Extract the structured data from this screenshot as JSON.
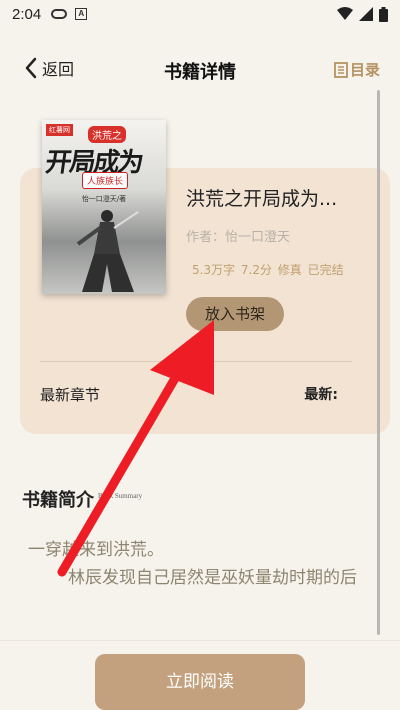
{
  "status_bar": {
    "time": "2:04",
    "icons": [
      "gamepad-icon",
      "a-icon",
      "wifi-icon",
      "signal-icon",
      "battery-icon"
    ]
  },
  "nav": {
    "back_label": "返回",
    "title": "书籍详情",
    "toc_label": "目录"
  },
  "book": {
    "title": "洪荒之开局成为...",
    "author": "作者：怡一口澄天",
    "meta": "5.3万字 7.2分 修真 已完结",
    "shelf_button": "放入书架",
    "latest_chapter_label": "最新章节",
    "latest_label": "最新:",
    "cover": {
      "badge": "红薯网",
      "top_tag": "洪荒之",
      "big_title": "开局成为",
      "bottom_tag": "人族族长",
      "author_line": "怡一口澄天/著"
    }
  },
  "intro": {
    "title": "书籍简介",
    "subtitle_en": "Book Summary",
    "line1": "一穿越来到洪荒。",
    "line2": "林辰发现自己居然是巫妖量劫时期的后"
  },
  "footer": {
    "read_button": "立即阅读"
  },
  "colors": {
    "background": "#f6f2ec",
    "card": "#f2e3d2",
    "accent": "#c4a17e",
    "shelf_button": "#b39775",
    "meta_text": "#c0a070",
    "annotation_arrow": "#ee1c24"
  }
}
